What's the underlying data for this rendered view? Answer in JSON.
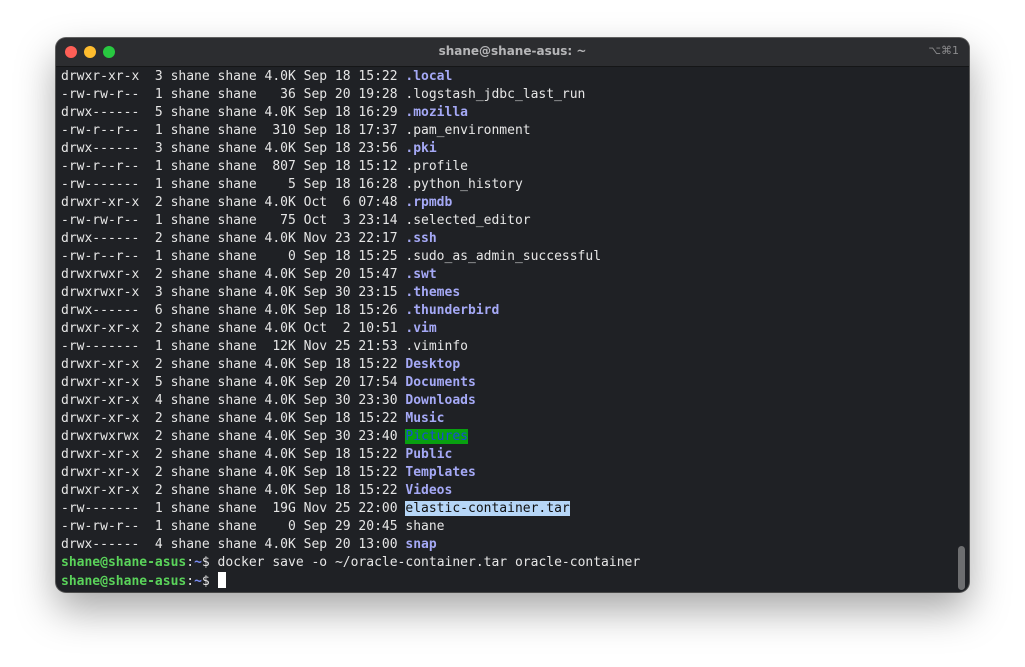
{
  "window": {
    "title": "shane@shane-asus: ~",
    "shortcut": "⌥⌘1"
  },
  "listing": [
    {
      "meta": "drwxr-xr-x  3 shane shane 4.0K Sep 18 15:22 ",
      "name": ".local",
      "kind": "dir"
    },
    {
      "meta": "-rw-rw-r--  1 shane shane   36 Sep 20 19:28 ",
      "name": ".logstash_jdbc_last_run",
      "kind": "file"
    },
    {
      "meta": "drwx------  5 shane shane 4.0K Sep 18 16:29 ",
      "name": ".mozilla",
      "kind": "dir"
    },
    {
      "meta": "-rw-r--r--  1 shane shane  310 Sep 18 17:37 ",
      "name": ".pam_environment",
      "kind": "file"
    },
    {
      "meta": "drwx------  3 shane shane 4.0K Sep 18 23:56 ",
      "name": ".pki",
      "kind": "dir"
    },
    {
      "meta": "-rw-r--r--  1 shane shane  807 Sep 18 15:12 ",
      "name": ".profile",
      "kind": "file"
    },
    {
      "meta": "-rw-------  1 shane shane    5 Sep 18 16:28 ",
      "name": ".python_history",
      "kind": "file"
    },
    {
      "meta": "drwxr-xr-x  2 shane shane 4.0K Oct  6 07:48 ",
      "name": ".rpmdb",
      "kind": "dir"
    },
    {
      "meta": "-rw-rw-r--  1 shane shane   75 Oct  3 23:14 ",
      "name": ".selected_editor",
      "kind": "file"
    },
    {
      "meta": "drwx------  2 shane shane 4.0K Nov 23 22:17 ",
      "name": ".ssh",
      "kind": "dir"
    },
    {
      "meta": "-rw-r--r--  1 shane shane    0 Sep 18 15:25 ",
      "name": ".sudo_as_admin_successful",
      "kind": "file"
    },
    {
      "meta": "drwxrwxr-x  2 shane shane 4.0K Sep 20 15:47 ",
      "name": ".swt",
      "kind": "dir"
    },
    {
      "meta": "drwxrwxr-x  3 shane shane 4.0K Sep 30 23:15 ",
      "name": ".themes",
      "kind": "dir"
    },
    {
      "meta": "drwx------  6 shane shane 4.0K Sep 18 15:26 ",
      "name": ".thunderbird",
      "kind": "dir"
    },
    {
      "meta": "drwxr-xr-x  2 shane shane 4.0K Oct  2 10:51 ",
      "name": ".vim",
      "kind": "dir"
    },
    {
      "meta": "-rw-------  1 shane shane  12K Nov 25 21:53 ",
      "name": ".viminfo",
      "kind": "file"
    },
    {
      "meta": "drwxr-xr-x  2 shane shane 4.0K Sep 18 15:22 ",
      "name": "Desktop",
      "kind": "dir"
    },
    {
      "meta": "drwxr-xr-x  5 shane shane 4.0K Sep 20 17:54 ",
      "name": "Documents",
      "kind": "dir"
    },
    {
      "meta": "drwxr-xr-x  4 shane shane 4.0K Sep 30 23:30 ",
      "name": "Downloads",
      "kind": "dir"
    },
    {
      "meta": "drwxr-xr-x  2 shane shane 4.0K Sep 18 15:22 ",
      "name": "Music",
      "kind": "dir"
    },
    {
      "meta": "drwxrwxrwx  2 shane shane 4.0K Sep 30 23:40 ",
      "name": "Pictures",
      "kind": "dir-world-writable"
    },
    {
      "meta": "drwxr-xr-x  2 shane shane 4.0K Sep 18 15:22 ",
      "name": "Public",
      "kind": "dir"
    },
    {
      "meta": "drwxr-xr-x  2 shane shane 4.0K Sep 18 15:22 ",
      "name": "Templates",
      "kind": "dir"
    },
    {
      "meta": "drwxr-xr-x  2 shane shane 4.0K Sep 18 15:22 ",
      "name": "Videos",
      "kind": "dir"
    },
    {
      "meta": "-rw-------  1 shane shane  19G Nov 25 22:00 ",
      "name": "elastic-container.tar",
      "kind": "selected"
    },
    {
      "meta": "-rw-rw-r--  1 shane shane    0 Sep 29 20:45 ",
      "name": "shane",
      "kind": "file"
    },
    {
      "meta": "drwx------  4 shane shane 4.0K Sep 20 13:00 ",
      "name": "snap",
      "kind": "dir"
    }
  ],
  "prompts": [
    {
      "user": "shane@shane-asus",
      "sep": ":",
      "path": "~",
      "symbol": "$ ",
      "command": "docker save -o ~/oracle-container.tar oracle-container"
    },
    {
      "user": "shane@shane-asus",
      "sep": ":",
      "path": "~",
      "symbol": "$ ",
      "command": ""
    }
  ],
  "colors": {
    "directory": "#a5a9f6",
    "prompt_user": "#5ad35a",
    "prompt_path": "#7a8cf3",
    "world_writable_bg": "#08a010",
    "selection_bg": "#b6d6f7"
  }
}
